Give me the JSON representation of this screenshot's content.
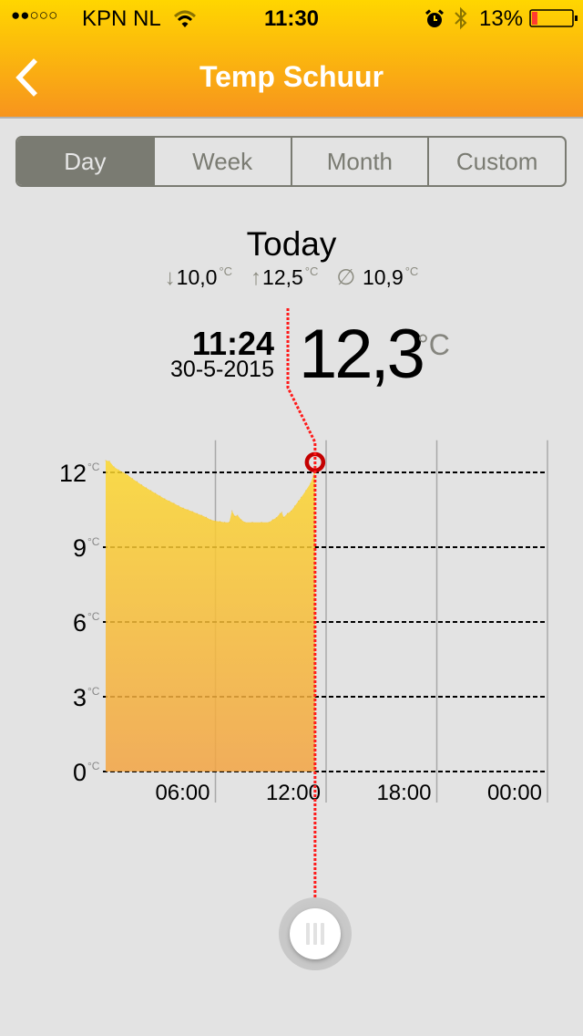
{
  "status_bar": {
    "signal": "●●○○○",
    "carrier": "KPN NL",
    "time": "11:30",
    "battery_percent": "13%",
    "battery_level": 0.13,
    "icons": [
      "wifi-icon",
      "alarm-icon",
      "bluetooth-icon",
      "battery-icon"
    ]
  },
  "nav": {
    "back_icon": "chevron-left-icon",
    "title": "Temp Schuur"
  },
  "tabs": [
    {
      "label": "Day",
      "selected": true
    },
    {
      "label": "Week",
      "selected": false
    },
    {
      "label": "Month",
      "selected": false
    },
    {
      "label": "Custom",
      "selected": false
    }
  ],
  "summary": {
    "period": "Today",
    "min_icon": "arrow-down-icon",
    "min": "10,0",
    "max_icon": "arrow-up-icon",
    "max": "12,5",
    "avg_icon": "average-icon",
    "avg": "10,9",
    "unit": "°C"
  },
  "reading": {
    "time": "11:24",
    "date": "30-5-2015",
    "value": "12,3",
    "unit": "°C"
  },
  "colors": {
    "nav_top": "#ffd600",
    "nav_bottom": "#f7941d",
    "accent": "#7a7b72",
    "fill_top": "#fcd82e",
    "fill_bottom": "#f3a443",
    "scrubber": "#ff1a1a",
    "marker": "#c40000",
    "battery_low": "#ff3b30"
  },
  "chart_data": {
    "type": "area",
    "title": "",
    "xlabel": "",
    "ylabel": "",
    "unit": "°C",
    "xlim": [
      0,
      24
    ],
    "ylim": [
      0,
      13
    ],
    "grid": true,
    "xticks": [
      6,
      12,
      18,
      24
    ],
    "xtick_labels": [
      "06:00",
      "12:00",
      "18:00",
      "00:00"
    ],
    "yticks": [
      0,
      3,
      6,
      9,
      12
    ],
    "ytick_labels": [
      "0",
      "3",
      "6",
      "9",
      "12"
    ],
    "x_units": "hours since 00:00",
    "x": [
      0.05,
      0.25,
      0.5,
      0.75,
      1.0,
      1.25,
      1.5,
      1.75,
      2.0,
      2.25,
      2.5,
      2.75,
      3.0,
      3.25,
      3.5,
      3.75,
      4.0,
      4.25,
      4.5,
      4.75,
      5.0,
      5.25,
      5.5,
      5.75,
      6.0,
      6.25,
      6.5,
      6.75,
      6.9,
      7.05,
      7.2,
      7.4,
      7.6,
      8.0,
      8.5,
      8.9,
      9.1,
      9.3,
      9.5,
      9.6,
      9.7,
      9.9,
      10.1,
      10.3,
      10.5,
      10.65,
      10.9,
      11.15,
      11.3,
      11.4
    ],
    "y": [
      12.48,
      12.45,
      12.22,
      12.1,
      12.0,
      11.89,
      11.75,
      11.63,
      11.5,
      11.38,
      11.27,
      11.16,
      11.05,
      10.94,
      10.85,
      10.76,
      10.66,
      10.57,
      10.5,
      10.43,
      10.35,
      10.28,
      10.2,
      10.1,
      10.05,
      10.03,
      10.0,
      10.0,
      10.46,
      10.24,
      10.28,
      10.1,
      10.0,
      10.0,
      10.0,
      10.0,
      10.1,
      10.18,
      10.35,
      10.4,
      10.2,
      10.35,
      10.45,
      10.65,
      10.85,
      11.0,
      11.27,
      11.56,
      11.85,
      12.3
    ],
    "scrubber": {
      "x": 11.4,
      "y": 12.3,
      "label_time": "11:24",
      "label_value": "12,3"
    }
  }
}
